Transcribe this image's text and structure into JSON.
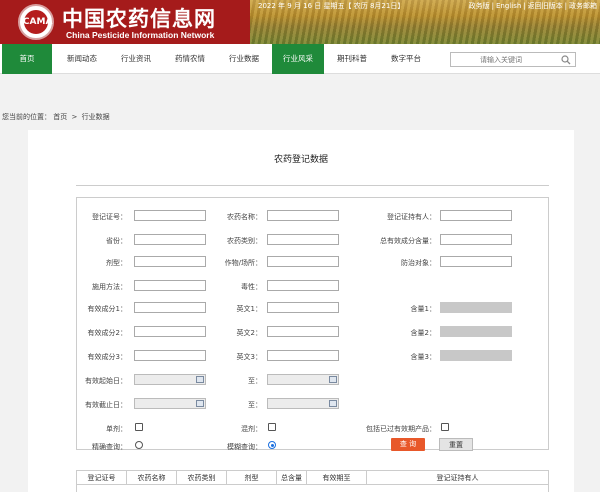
{
  "header": {
    "logo_text": "ICAMA",
    "title": "中国农药信息网",
    "subtitle": "China Pesticide Information Network",
    "date": "2022 年 9 月 16 日 星期五【 农历 8月21日】",
    "links": [
      "政务版",
      "English",
      "返回旧版本",
      "政务邮箱"
    ]
  },
  "nav": {
    "items": [
      "首页",
      "新闻动态",
      "行业资讯",
      "药情农情",
      "行业数据",
      "行业风采",
      "期刊科普",
      "数字平台"
    ],
    "active_index": 5,
    "search_placeholder": "请输入关键词"
  },
  "breadcrumb": {
    "prefix": "您当前的位置：",
    "items": [
      "首页",
      "行业数据"
    ],
    "separator": ">"
  },
  "panel": {
    "title": "农药登记数据"
  },
  "form": {
    "row1": [
      "登记证号：",
      "农药名称：",
      "登记证持有人："
    ],
    "row2": [
      "省份：",
      "农药类别：",
      "总有效成分含量："
    ],
    "row3": [
      "剂型：",
      "作物/场所：",
      "防治对象："
    ],
    "row4": [
      "施用方法：",
      "毒性："
    ],
    "row5": [
      "有效成分1：",
      "英文1：",
      "含量1："
    ],
    "row6": [
      "有效成分2：",
      "英文2：",
      "含量2："
    ],
    "row7": [
      "有效成分3：",
      "英文3：",
      "含量3："
    ],
    "row8": [
      "有效起始日：",
      "至："
    ],
    "row9": [
      "有效截止日：",
      "至："
    ],
    "single_label": "单剂：",
    "mixed_label": "混剂：",
    "include_expired_label": "包括已过有效期产品：",
    "exact_label": "精确查询：",
    "fuzzy_label": "模糊查询：",
    "query_button": "查 询",
    "reset_button": "重置"
  },
  "table": {
    "columns": [
      "登记证号",
      "农药名称",
      "农药类别",
      "剂型",
      "总含量",
      "有效期至",
      "登记证持有人"
    ]
  },
  "colors": {
    "brand_red": "#a51b1b",
    "nav_active": "#1f8a3a",
    "query_button": "#e8582a"
  }
}
